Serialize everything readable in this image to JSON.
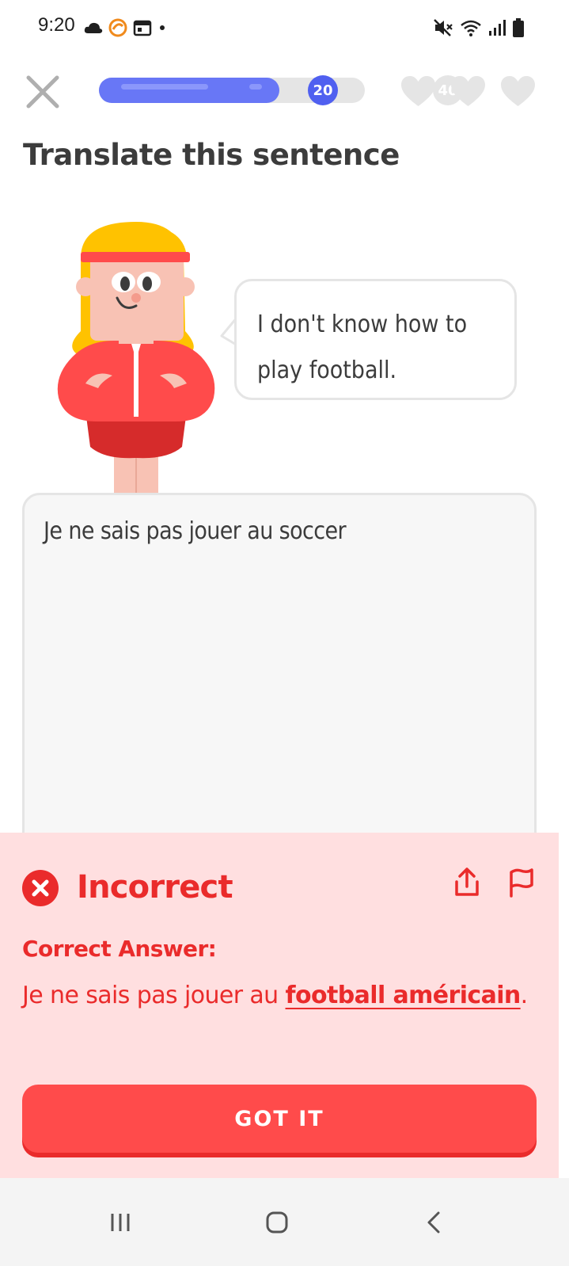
{
  "status_bar": {
    "time": "9:20",
    "left_icons": [
      "cloud-icon",
      "app-notification-icon",
      "calendar-icon",
      "dot-icon"
    ],
    "right_icons": [
      "mute-icon",
      "wifi-icon",
      "signal-icon",
      "battery-icon"
    ]
  },
  "header": {
    "progress": {
      "fraction": 0.68,
      "milestone_current": "20",
      "milestone_next": "40"
    },
    "hearts": [
      "heart-icon",
      "heart-icon",
      "heart-icon"
    ]
  },
  "lesson": {
    "title": "Translate this sentence",
    "prompt": "I don't know how to play football."
  },
  "answer": {
    "value": "Je ne sais pas jouer au soccer"
  },
  "feedback": {
    "status": "Incorrect",
    "correct_label": "Correct Answer:",
    "correct_answer_prefix": "Je ne sais pas jouer au ",
    "correct_answer_highlight": "football américain",
    "correct_answer_suffix": ".",
    "button_label": "GOT IT"
  },
  "colors": {
    "progress": "#6877f6",
    "error": "#ea2b2b",
    "feedback_bg": "#ffdfe0",
    "button": "#ff4b4b"
  }
}
